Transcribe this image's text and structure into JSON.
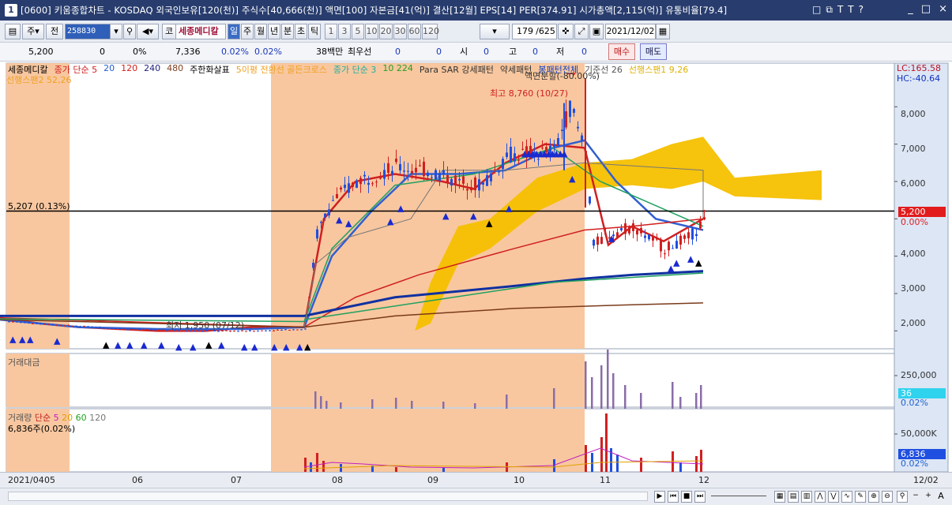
{
  "window": {
    "number": "1",
    "title": "[0600] 키움종합차트 - KOSDAQ 외국인보유[120(천)] 주식수[40,666(천)] 액면[100] 자본금[41(억)] 결산[12월] EPS[14] PER[374.91] 시가총액[2,115(억)] 유통비율[79.4]",
    "tools": [
      "□",
      "⧉",
      "T",
      "T",
      "?"
    ],
    "controls": [
      "_",
      "□",
      "×"
    ]
  },
  "toolbar": {
    "period_main": "주",
    "prev_label": "전",
    "stock_code": "258830",
    "market_btn": "코",
    "stock_name": "세종메디칼",
    "periods": [
      "일",
      "주",
      "월",
      "년",
      "분",
      "초",
      "틱"
    ],
    "selected_period": "일",
    "intervals": [
      "1",
      "3",
      "5",
      "10",
      "20",
      "30",
      "60",
      "120"
    ],
    "page_count": "179",
    "page_total": "/625",
    "date": "2021/12/02"
  },
  "info_bar": {
    "price": "5,200",
    "change": "0",
    "change_pct": "0%",
    "volume": "7,336",
    "vol_pct1": "0.02%",
    "vol_pct2": "0.02%",
    "amount": "38백만",
    "pref_label": "최우선",
    "pref_v1": "0",
    "pref_v2": "0",
    "open_label": "시",
    "open_v": "0",
    "high_label": "고",
    "high_v": "0",
    "low_label": "저",
    "low_v": "0",
    "buy_label": "매수",
    "sell_label": "매도"
  },
  "chart": {
    "legend": [
      {
        "text": "세종메디칼",
        "color": "#000000"
      },
      {
        "text": "종가 단순 5",
        "color": "#d02020"
      },
      {
        "text": "20",
        "color": "#2060d0"
      },
      {
        "text": "120",
        "color": "#d02020"
      },
      {
        "text": "240",
        "color": "#202080"
      },
      {
        "text": "480",
        "color": "#804020"
      },
      {
        "text": "주한화살표",
        "color": "#000000"
      },
      {
        "text": "5이평 전환선 골든크로스",
        "color": "#f0a020"
      },
      {
        "text": "종가 단순 3",
        "color": "#20b0a0"
      },
      {
        "text": "10 224",
        "color": "#20a020"
      },
      {
        "text": "Para SAR 강세패턴",
        "color": "#333333"
      },
      {
        "text": "약세패턴",
        "color": "#333333"
      },
      {
        "text": "봉패턴전체",
        "color": "#1040c0"
      },
      {
        "text": "기준선 26",
        "color": "#555555"
      },
      {
        "text": "선행스팬1 9,26",
        "color": "#e0b000"
      }
    ],
    "legend2": "선행스팬2 52,26",
    "lc": "LC:165.58",
    "hc": "HC:-40.64",
    "annotations": {
      "high": "최고 8,760 (10/27)",
      "low": "최저 1,950 (07/12)",
      "split": "액면분할(-80.00%)",
      "hline": "5,207 (0.13%)"
    },
    "price_axis": [
      "8,000",
      "7,000",
      "6,000",
      "5,000",
      "4,000",
      "3,000",
      "2,000"
    ],
    "price_box": "5,200",
    "price_box_pct": "0.00%",
    "colors": {
      "up": "#d02020",
      "down": "#1f4fe0",
      "band": "#f8c79f",
      "cloud": "#f6c000"
    },
    "amount_pane": {
      "label": "거래대금",
      "tick": "250,000",
      "box": "36",
      "pct": "0.02%"
    },
    "volume_pane": {
      "label1": "거래량",
      "label2": "단순",
      "ma": [
        "5",
        "20",
        "60",
        "120"
      ],
      "sub": "6,836주(0.02%)",
      "tick": "50,000K",
      "box": "6,836",
      "pct": "0.02%"
    },
    "x_axis": [
      "2021/04",
      "05",
      "06",
      "07",
      "08",
      "09",
      "10",
      "11",
      "12"
    ],
    "x_right": "12/02"
  },
  "chart_data": {
    "type": "candlestick",
    "title": "세종메디칼",
    "x_range": [
      "2021/04",
      "2021/12/02"
    ],
    "y_range": [
      1500,
      9000
    ],
    "ma_series": [
      {
        "name": "종가 단순 5",
        "points": [
          [
            0,
            2350
          ],
          [
            50,
            2200
          ],
          [
            100,
            2100
          ],
          [
            150,
            2050
          ],
          [
            200,
            2000
          ],
          [
            260,
            2000
          ],
          [
            320,
            2100
          ],
          [
            385,
            2100
          ],
          [
            410,
            5000
          ],
          [
            450,
            6000
          ],
          [
            500,
            6200
          ],
          [
            560,
            6000
          ],
          [
            600,
            5800
          ],
          [
            640,
            6500
          ],
          [
            690,
            7000
          ],
          [
            740,
            6900
          ],
          [
            770,
            4300
          ],
          [
            800,
            4800
          ],
          [
            840,
            4400
          ],
          [
            890,
            5000
          ]
        ]
      },
      {
        "name": "20",
        "points": [
          [
            0,
            2300
          ],
          [
            100,
            2100
          ],
          [
            200,
            2050
          ],
          [
            320,
            2050
          ],
          [
            385,
            2100
          ],
          [
            420,
            4000
          ],
          [
            470,
            5200
          ],
          [
            520,
            6200
          ],
          [
            580,
            6200
          ],
          [
            640,
            6300
          ],
          [
            700,
            6900
          ],
          [
            740,
            7100
          ],
          [
            780,
            6000
          ],
          [
            830,
            5000
          ],
          [
            890,
            4700
          ]
        ]
      },
      {
        "name": "120",
        "points": [
          [
            0,
            2350
          ],
          [
            385,
            2100
          ],
          [
            450,
            2900
          ],
          [
            530,
            3500
          ],
          [
            650,
            4200
          ],
          [
            740,
            4700
          ],
          [
            800,
            4800
          ],
          [
            890,
            5000
          ]
        ]
      },
      {
        "name": "240",
        "points": [
          [
            0,
            2400
          ],
          [
            385,
            2400
          ],
          [
            500,
            2900
          ],
          [
            650,
            3200
          ],
          [
            740,
            3400
          ],
          [
            800,
            3500
          ],
          [
            890,
            3600
          ]
        ]
      },
      {
        "name": "480",
        "points": [
          [
            0,
            2300
          ],
          [
            385,
            2100
          ],
          [
            500,
            2400
          ],
          [
            650,
            2600
          ],
          [
            800,
            2700
          ],
          [
            890,
            2750
          ]
        ]
      }
    ],
    "ichimoku_cloud": [
      [
        525,
        2000
      ],
      [
        545,
        3300
      ],
      [
        580,
        4800
      ],
      [
        620,
        5000
      ],
      [
        680,
        6100
      ],
      [
        740,
        6500
      ],
      [
        800,
        6600
      ],
      [
        850,
        7000
      ],
      [
        890,
        7200
      ],
      [
        930,
        6100
      ],
      [
        1040,
        6300
      ]
    ],
    "volume_bars": [
      [
        385,
        20
      ],
      [
        400,
        45
      ],
      [
        430,
        40
      ],
      [
        500,
        30
      ],
      [
        550,
        25
      ],
      [
        600,
        20
      ],
      [
        640,
        35
      ],
      [
        700,
        50
      ],
      [
        740,
        90
      ],
      [
        760,
        100
      ],
      [
        780,
        70
      ],
      [
        810,
        60
      ],
      [
        850,
        40
      ],
      [
        885,
        45
      ]
    ],
    "annotations": {
      "max": {
        "price": 8760,
        "date": "10/27"
      },
      "min": {
        "price": 1950,
        "date": "07/12"
      }
    }
  }
}
